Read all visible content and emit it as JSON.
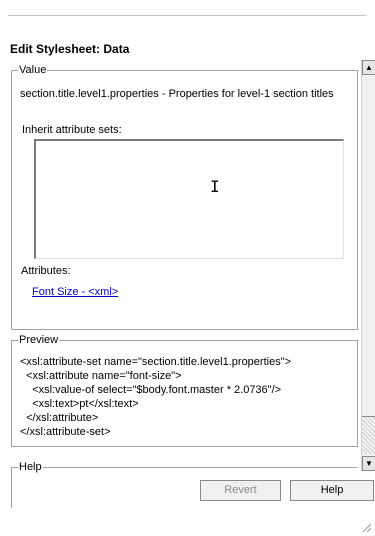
{
  "dialog": {
    "title": "Edit Stylesheet: Data"
  },
  "value_group": {
    "legend": "Value",
    "property_description": "section.title.level1.properties - Properties for level-1 section titles",
    "inherit_label": "Inherit attribute sets:",
    "attributes_label": "Attributes:",
    "attribute_link": "Font Size - <xml>"
  },
  "preview_group": {
    "legend": "Preview",
    "lines": [
      "<xsl:attribute-set name=\"section.title.level1.properties\">",
      "  <xsl:attribute name=\"font-size\">",
      "    <xsl:value-of select=\"$body.font.master * 2.0736\"/>",
      "    <xsl:text>pt</xsl:text>",
      "  </xsl:attribute>",
      "</xsl:attribute-set>"
    ]
  },
  "help_group": {
    "legend": "Help"
  },
  "buttons": {
    "revert": "Revert",
    "help": "Help"
  },
  "icons": {
    "scroll_up": "arrow-up-icon",
    "scroll_down": "arrow-down-icon",
    "text_cursor": "i-beam-cursor-icon",
    "resize": "resize-grip-icon"
  }
}
